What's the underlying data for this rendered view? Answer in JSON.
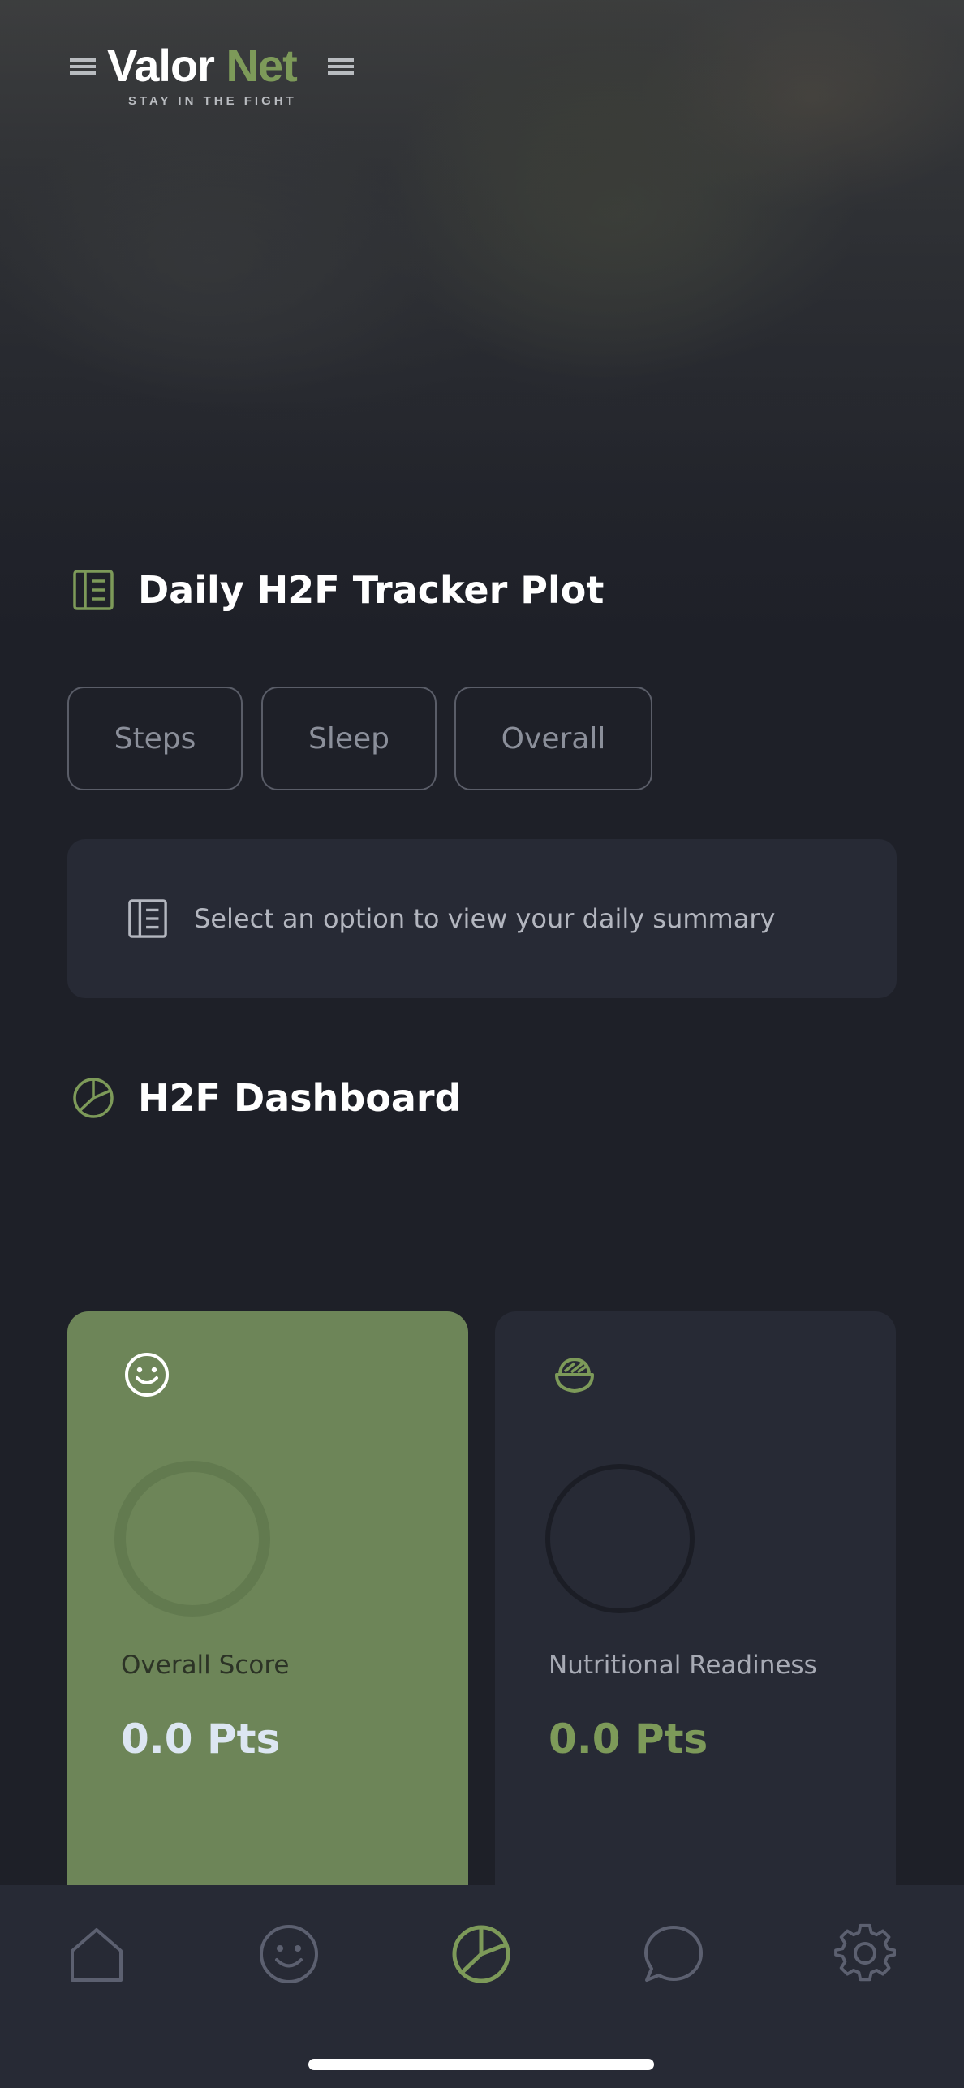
{
  "app": {
    "brand_first": "Valor",
    "brand_second": "Net",
    "tagline": "STAY IN THE FIGHT",
    "accent_color": "#7d9a59"
  },
  "tracker": {
    "title": "Daily H2F Tracker Plot",
    "icon": "document-list-icon",
    "options": [
      "Steps",
      "Sleep",
      "Overall"
    ],
    "summary_text": "Select an option to view your daily summary"
  },
  "dashboard": {
    "title": "H2F Dashboard",
    "icon": "pie-chart-icon",
    "cards": [
      {
        "icon": "smiley-icon",
        "label": "Overall Score",
        "value": "0.0 Pts",
        "color": "#6d8558"
      },
      {
        "icon": "food-bowl-icon",
        "label": "Nutritional Readiness",
        "value": "0.0 Pts",
        "color": "#272a35"
      }
    ]
  },
  "nav": {
    "items": [
      {
        "icon": "home-icon",
        "active": false
      },
      {
        "icon": "smiley-icon",
        "active": false
      },
      {
        "icon": "pie-chart-icon",
        "active": true
      },
      {
        "icon": "chat-bubble-icon",
        "active": false
      },
      {
        "icon": "gear-icon",
        "active": false
      }
    ],
    "active_color": "#7d9a59",
    "inactive_color": "#5c6070"
  }
}
